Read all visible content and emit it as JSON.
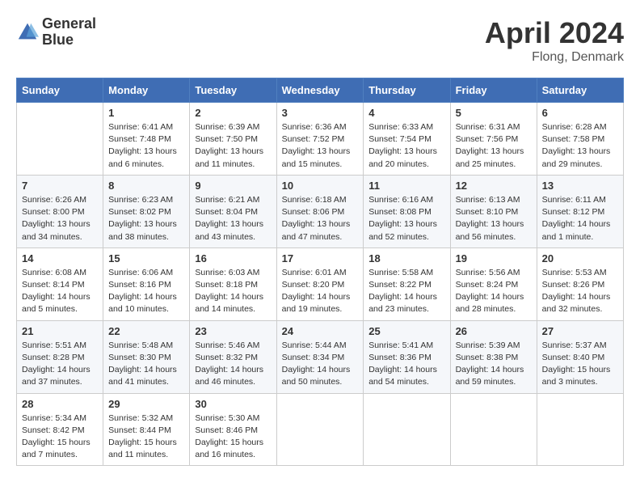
{
  "header": {
    "logo_line1": "General",
    "logo_line2": "Blue",
    "month_year": "April 2024",
    "location": "Flong, Denmark"
  },
  "days_of_week": [
    "Sunday",
    "Monday",
    "Tuesday",
    "Wednesday",
    "Thursday",
    "Friday",
    "Saturday"
  ],
  "weeks": [
    [
      {
        "day": "",
        "info": ""
      },
      {
        "day": "1",
        "info": "Sunrise: 6:41 AM\nSunset: 7:48 PM\nDaylight: 13 hours\nand 6 minutes."
      },
      {
        "day": "2",
        "info": "Sunrise: 6:39 AM\nSunset: 7:50 PM\nDaylight: 13 hours\nand 11 minutes."
      },
      {
        "day": "3",
        "info": "Sunrise: 6:36 AM\nSunset: 7:52 PM\nDaylight: 13 hours\nand 15 minutes."
      },
      {
        "day": "4",
        "info": "Sunrise: 6:33 AM\nSunset: 7:54 PM\nDaylight: 13 hours\nand 20 minutes."
      },
      {
        "day": "5",
        "info": "Sunrise: 6:31 AM\nSunset: 7:56 PM\nDaylight: 13 hours\nand 25 minutes."
      },
      {
        "day": "6",
        "info": "Sunrise: 6:28 AM\nSunset: 7:58 PM\nDaylight: 13 hours\nand 29 minutes."
      }
    ],
    [
      {
        "day": "7",
        "info": "Sunrise: 6:26 AM\nSunset: 8:00 PM\nDaylight: 13 hours\nand 34 minutes."
      },
      {
        "day": "8",
        "info": "Sunrise: 6:23 AM\nSunset: 8:02 PM\nDaylight: 13 hours\nand 38 minutes."
      },
      {
        "day": "9",
        "info": "Sunrise: 6:21 AM\nSunset: 8:04 PM\nDaylight: 13 hours\nand 43 minutes."
      },
      {
        "day": "10",
        "info": "Sunrise: 6:18 AM\nSunset: 8:06 PM\nDaylight: 13 hours\nand 47 minutes."
      },
      {
        "day": "11",
        "info": "Sunrise: 6:16 AM\nSunset: 8:08 PM\nDaylight: 13 hours\nand 52 minutes."
      },
      {
        "day": "12",
        "info": "Sunrise: 6:13 AM\nSunset: 8:10 PM\nDaylight: 13 hours\nand 56 minutes."
      },
      {
        "day": "13",
        "info": "Sunrise: 6:11 AM\nSunset: 8:12 PM\nDaylight: 14 hours\nand 1 minute."
      }
    ],
    [
      {
        "day": "14",
        "info": "Sunrise: 6:08 AM\nSunset: 8:14 PM\nDaylight: 14 hours\nand 5 minutes."
      },
      {
        "day": "15",
        "info": "Sunrise: 6:06 AM\nSunset: 8:16 PM\nDaylight: 14 hours\nand 10 minutes."
      },
      {
        "day": "16",
        "info": "Sunrise: 6:03 AM\nSunset: 8:18 PM\nDaylight: 14 hours\nand 14 minutes."
      },
      {
        "day": "17",
        "info": "Sunrise: 6:01 AM\nSunset: 8:20 PM\nDaylight: 14 hours\nand 19 minutes."
      },
      {
        "day": "18",
        "info": "Sunrise: 5:58 AM\nSunset: 8:22 PM\nDaylight: 14 hours\nand 23 minutes."
      },
      {
        "day": "19",
        "info": "Sunrise: 5:56 AM\nSunset: 8:24 PM\nDaylight: 14 hours\nand 28 minutes."
      },
      {
        "day": "20",
        "info": "Sunrise: 5:53 AM\nSunset: 8:26 PM\nDaylight: 14 hours\nand 32 minutes."
      }
    ],
    [
      {
        "day": "21",
        "info": "Sunrise: 5:51 AM\nSunset: 8:28 PM\nDaylight: 14 hours\nand 37 minutes."
      },
      {
        "day": "22",
        "info": "Sunrise: 5:48 AM\nSunset: 8:30 PM\nDaylight: 14 hours\nand 41 minutes."
      },
      {
        "day": "23",
        "info": "Sunrise: 5:46 AM\nSunset: 8:32 PM\nDaylight: 14 hours\nand 46 minutes."
      },
      {
        "day": "24",
        "info": "Sunrise: 5:44 AM\nSunset: 8:34 PM\nDaylight: 14 hours\nand 50 minutes."
      },
      {
        "day": "25",
        "info": "Sunrise: 5:41 AM\nSunset: 8:36 PM\nDaylight: 14 hours\nand 54 minutes."
      },
      {
        "day": "26",
        "info": "Sunrise: 5:39 AM\nSunset: 8:38 PM\nDaylight: 14 hours\nand 59 minutes."
      },
      {
        "day": "27",
        "info": "Sunrise: 5:37 AM\nSunset: 8:40 PM\nDaylight: 15 hours\nand 3 minutes."
      }
    ],
    [
      {
        "day": "28",
        "info": "Sunrise: 5:34 AM\nSunset: 8:42 PM\nDaylight: 15 hours\nand 7 minutes."
      },
      {
        "day": "29",
        "info": "Sunrise: 5:32 AM\nSunset: 8:44 PM\nDaylight: 15 hours\nand 11 minutes."
      },
      {
        "day": "30",
        "info": "Sunrise: 5:30 AM\nSunset: 8:46 PM\nDaylight: 15 hours\nand 16 minutes."
      },
      {
        "day": "",
        "info": ""
      },
      {
        "day": "",
        "info": ""
      },
      {
        "day": "",
        "info": ""
      },
      {
        "day": "",
        "info": ""
      }
    ]
  ]
}
